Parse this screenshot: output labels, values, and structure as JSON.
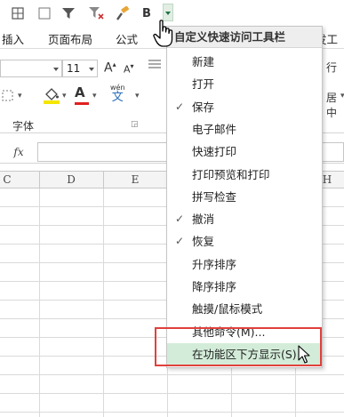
{
  "quick_access_toolbar": {
    "icons": [
      "table-icon",
      "filter-icon",
      "clear-filter-icon",
      "format-painter-icon"
    ],
    "bold_label": "B"
  },
  "ribbon_tabs": [
    "插入",
    "页面布局",
    "公式",
    "发工具"
  ],
  "font_group": {
    "font_size": "11",
    "grow_font": "A",
    "shrink_font": "A",
    "font_color_letter": "A",
    "phonetic_label": "wén",
    "phonetic_char": "文",
    "group_label": "字体",
    "align_center_label": "居中",
    "align_dropdown_marker": "▾"
  },
  "formula_bar": {
    "fx_label": "fx",
    "value": ""
  },
  "column_headers": [
    "C",
    "D",
    "E",
    "H"
  ],
  "qat_menu": {
    "title": "自定义快速访问工具栏",
    "items": [
      {
        "label": "新建",
        "checked": false
      },
      {
        "label": "打开",
        "checked": false
      },
      {
        "label": "保存",
        "checked": true
      },
      {
        "label": "电子邮件",
        "checked": false
      },
      {
        "label": "快速打印",
        "checked": false
      },
      {
        "label": "打印预览和打印",
        "checked": false
      },
      {
        "label": "拼写检查",
        "checked": false
      },
      {
        "label": "撤消",
        "checked": true
      },
      {
        "label": "恢复",
        "checked": true
      },
      {
        "label": "升序排序",
        "checked": false
      },
      {
        "label": "降序排序",
        "checked": false
      },
      {
        "label": "触摸/鼠标模式",
        "checked": false
      },
      {
        "label": "其他命令(M)...",
        "checked": false
      },
      {
        "label": "在功能区下方显示(S)",
        "checked": false,
        "hover": true
      }
    ],
    "check_glyph": "✓"
  },
  "colors": {
    "accent_green": "#217346",
    "hover_green": "#d3ecd9",
    "highlight_red": "#e0413c",
    "font_color_underline": "#e02020",
    "fill_color_underline": "#f5e600"
  }
}
